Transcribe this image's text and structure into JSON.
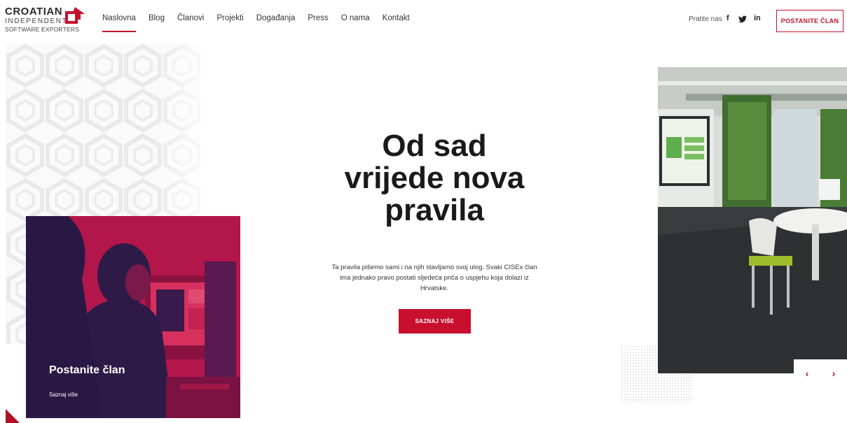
{
  "header": {
    "logo": {
      "line1": "CROATIAN",
      "line2": "INDEPENDENT",
      "line3": "SOFTWARE EXPORTERS"
    },
    "nav": [
      "Naslovna",
      "Blog",
      "Članovi",
      "Projekti",
      "Događanja",
      "Press",
      "O nama",
      "Kontakt"
    ],
    "active_nav": "Naslovna",
    "follow_label": "Pratite nas",
    "social": {
      "facebook": "f",
      "twitter": "twitter-icon",
      "linkedin": "in"
    },
    "cta_label": "POSTANITE ČLAN"
  },
  "hero": {
    "title_lines": [
      "Od sad",
      "vrijede nova",
      "pravila"
    ],
    "text": "Ta pravila pišemo sami i na njih stavljamo svoj ulog. Svaki CISEx član ima jednako pravo postati sljedeća priča o uspjehu koja dolazi iz Hrvatske.",
    "button_label": "SAZNAJ VIŠE"
  },
  "member_card": {
    "title": "Postanite član",
    "link": "Saznaj više"
  },
  "slider": {
    "prev": "‹",
    "next": "›"
  },
  "colors": {
    "accent": "#c8102e",
    "card_overlay": "#b5164a",
    "card_dark": "#2e1a47"
  }
}
